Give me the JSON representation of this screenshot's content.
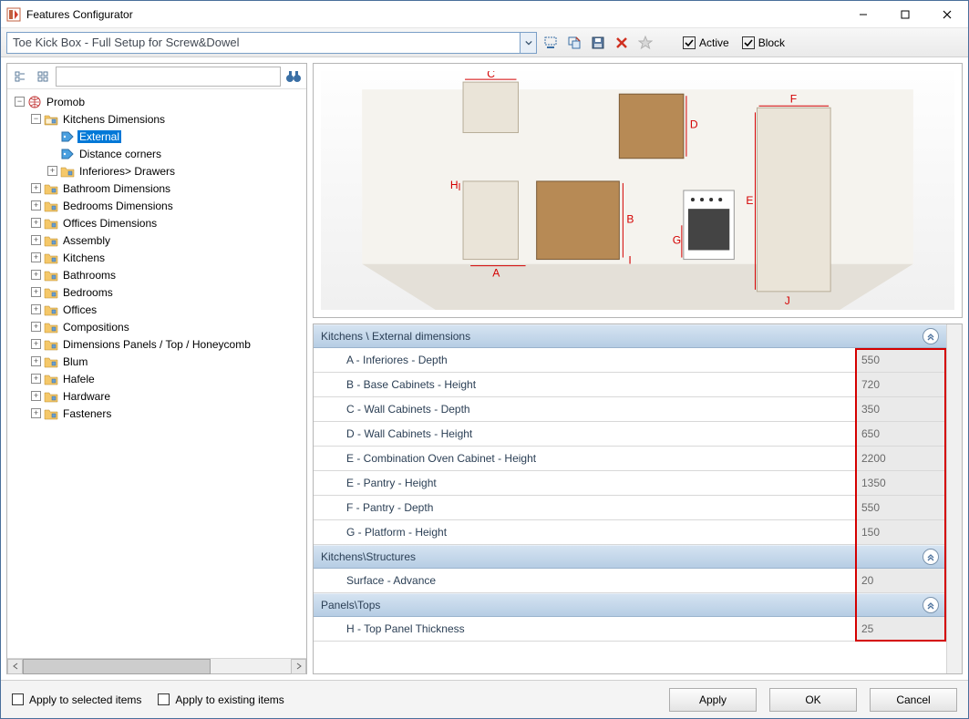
{
  "window": {
    "title": "Features Configurator"
  },
  "toolbar": {
    "combo_value": "Toe Kick Box - Full Setup for Screw&Dowel",
    "active_label": "Active",
    "block_label": "Block",
    "icons": {
      "select_tool": "select-area-icon",
      "copy_tool": "duplicate-icon",
      "save": "save-icon",
      "delete": "delete-icon",
      "star": "star-icon"
    }
  },
  "left": {
    "search_placeholder": ""
  },
  "tree": {
    "root": "Promob",
    "items": [
      {
        "label": "Kitchens Dimensions",
        "expanded": true,
        "children": [
          {
            "label": "External",
            "type": "tag",
            "selected": true
          },
          {
            "label": "Distance corners",
            "type": "tag"
          },
          {
            "label": "Inferiores> Drawers",
            "type": "folder",
            "expander": "+"
          }
        ]
      },
      {
        "label": "Bathroom Dimensions"
      },
      {
        "label": "Bedrooms Dimensions"
      },
      {
        "label": "Offices Dimensions"
      },
      {
        "label": "Assembly"
      },
      {
        "label": "Kitchens"
      },
      {
        "label": "Bathrooms"
      },
      {
        "label": "Bedrooms"
      },
      {
        "label": "Offices"
      },
      {
        "label": "Compositions"
      },
      {
        "label": "Dimensions Panels / Top / Honeycomb"
      },
      {
        "label": "Blum"
      },
      {
        "label": "Hafele"
      },
      {
        "label": "Hardware"
      },
      {
        "label": "Fasteners"
      }
    ]
  },
  "preview": {
    "dimension_labels": [
      "A",
      "B",
      "C",
      "D",
      "E",
      "F",
      "G",
      "H",
      "I",
      "J"
    ]
  },
  "groups": [
    {
      "title": "Kitchens \\ External dimensions",
      "rows": [
        {
          "label": "A - Inferiores - Depth",
          "value": "550"
        },
        {
          "label": "B - Base Cabinets - Height",
          "value": "720"
        },
        {
          "label": "C - Wall Cabinets - Depth",
          "value": "350"
        },
        {
          "label": "D - Wall Cabinets - Height",
          "value": "650"
        },
        {
          "label": "E - Combination Oven Cabinet - Height",
          "value": "2200"
        },
        {
          "label": "E - Pantry - Height",
          "value": "1350"
        },
        {
          "label": "F - Pantry - Depth",
          "value": "550"
        },
        {
          "label": "G - Platform - Height",
          "value": "150"
        }
      ]
    },
    {
      "title": "Kitchens\\Structures",
      "rows": [
        {
          "label": "Surface - Advance",
          "value": "20"
        }
      ]
    },
    {
      "title": "Panels\\Tops",
      "rows": [
        {
          "label": "H - Top Panel Thickness",
          "value": "25"
        }
      ]
    }
  ],
  "bottom": {
    "apply_selected": "Apply to selected items",
    "apply_existing": "Apply to existing items",
    "apply": "Apply",
    "ok": "OK",
    "cancel": "Cancel"
  }
}
